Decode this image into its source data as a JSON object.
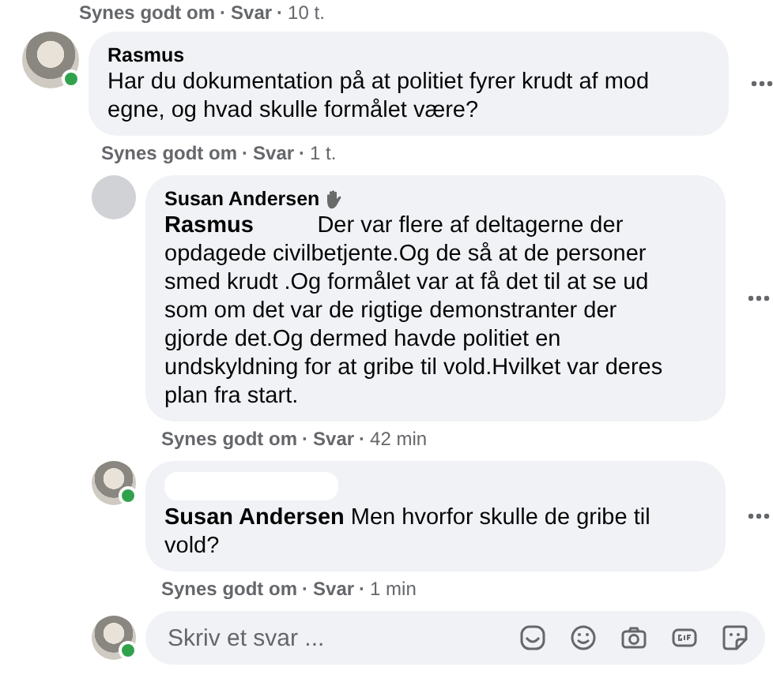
{
  "top_meta": [
    {
      "kind": "link",
      "text": "Synes godt om"
    },
    {
      "kind": "sep",
      "text": "·"
    },
    {
      "kind": "link",
      "text": "Svar"
    },
    {
      "kind": "sep",
      "text": "·"
    },
    {
      "kind": "time",
      "text": "10 t."
    }
  ],
  "comments": [
    {
      "kind": "comment",
      "author": "Rasmus",
      "avatar": {
        "kind": "photo"
      },
      "online": true,
      "badge": false,
      "text": "Har du dokumentation på at politiet fyrer krudt af mod egne, og hvad skulle formålet være?",
      "meta": [
        {
          "kind": "link",
          "text": "Synes godt om"
        },
        {
          "kind": "sep",
          "text": "·"
        },
        {
          "kind": "link",
          "text": "Svar"
        },
        {
          "kind": "sep",
          "text": "·"
        },
        {
          "kind": "time",
          "text": "1 t."
        }
      ]
    },
    {
      "kind": "reply",
      "author": "Susan Andersen",
      "avatar": {
        "kind": "blank"
      },
      "online": false,
      "badge": true,
      "text": "**Rasmus**          Der var flere af deltagerne der opdagede civilbetjente.Og de så at de personer smed krudt .Og formålet var at få det til at se ud som om det var de rigtige demonstranter der gjorde det.Og dermed havde politiet en undskyldning for at gribe til vold.Hvilket var deres plan fra start.",
      "meta": [
        {
          "kind": "link",
          "text": "Synes godt om"
        },
        {
          "kind": "sep",
          "text": "·"
        },
        {
          "kind": "link",
          "text": "Svar"
        },
        {
          "kind": "sep",
          "text": "·"
        },
        {
          "kind": "time",
          "text": "42 min"
        }
      ]
    },
    {
      "kind": "reply",
      "avatar": {
        "kind": "photo"
      },
      "online": true,
      "badge": false,
      "text": "**Susan Andersen** Men hvorfor skulle de gribe til vold?",
      "meta": [
        {
          "kind": "link",
          "text": "Synes godt om"
        },
        {
          "kind": "sep",
          "text": "·"
        },
        {
          "kind": "link",
          "text": "Svar"
        },
        {
          "kind": "sep",
          "text": "·"
        },
        {
          "kind": "time",
          "text": "1 min"
        }
      ]
    }
  ],
  "composer": {
    "placeholder": "Skriv et svar ...",
    "avatar": {
      "kind": "photo"
    },
    "online": true
  }
}
